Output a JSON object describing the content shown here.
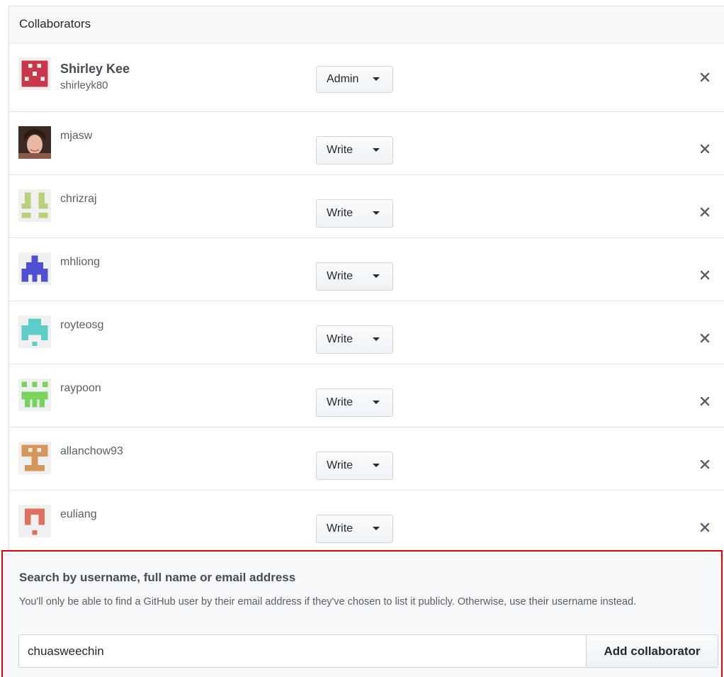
{
  "header": {
    "title": "Collaborators"
  },
  "collaborators": [
    {
      "full_name": "Shirley Kee",
      "login": "shirleyk80",
      "permission": "Admin",
      "avatar": "identicon-red",
      "color": "#c8374a"
    },
    {
      "full_name": "",
      "login": "mjasw",
      "permission": "Write",
      "avatar": "photo-avatar",
      "color": "#7a4a3a"
    },
    {
      "full_name": "",
      "login": "chrizraj",
      "permission": "Write",
      "avatar": "identicon-green",
      "color": "#b7d27a"
    },
    {
      "full_name": "",
      "login": "mhliong",
      "permission": "Write",
      "avatar": "identicon-blue",
      "color": "#4f4fd3"
    },
    {
      "full_name": "",
      "login": "royteosg",
      "permission": "Write",
      "avatar": "identicon-teal",
      "color": "#5ecdc7"
    },
    {
      "full_name": "",
      "login": "raypoon",
      "permission": "Write",
      "avatar": "identicon-lime",
      "color": "#7ad35b"
    },
    {
      "full_name": "",
      "login": "allanchow93",
      "permission": "Write",
      "avatar": "identicon-tan",
      "color": "#d6955a"
    },
    {
      "full_name": "",
      "login": "euliang",
      "permission": "Write",
      "avatar": "identicon-salmon",
      "color": "#e0705b"
    }
  ],
  "add": {
    "title": "Search by username, full name or email address",
    "note": "You'll only be able to find a GitHub user by their email address if they've chosen to list it publicly. Otherwise, use their username instead.",
    "input_value": "chuasweechin",
    "button_label": "Add collaborator",
    "highlight_color": "#e60000"
  }
}
